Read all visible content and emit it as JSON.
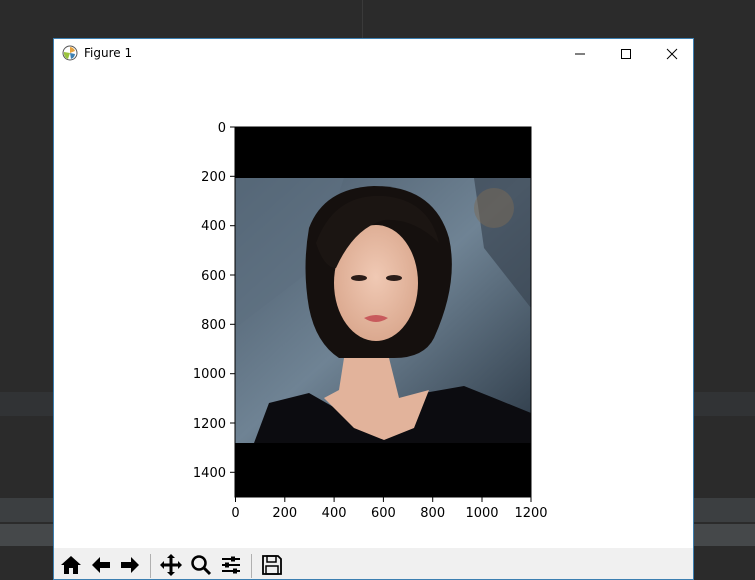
{
  "window": {
    "title": "Figure 1"
  },
  "figure": {
    "y_ticks": [
      "0",
      "200",
      "400",
      "600",
      "800",
      "1000",
      "1200",
      "1400"
    ],
    "x_ticks": [
      "0",
      "200",
      "400",
      "600",
      "800",
      "1000",
      "1200"
    ],
    "image_description_icon": "portrait-photo"
  },
  "toolbar": {
    "buttons": [
      "home-icon",
      "back-icon",
      "forward-icon",
      "pan-icon",
      "zoom-icon",
      "configure-subplots-icon",
      "save-icon"
    ]
  },
  "colors": {
    "window_border": "#3c7fb1",
    "toolbar_bg": "#f0f0f0",
    "ide_bg": "#2b2b2b"
  }
}
